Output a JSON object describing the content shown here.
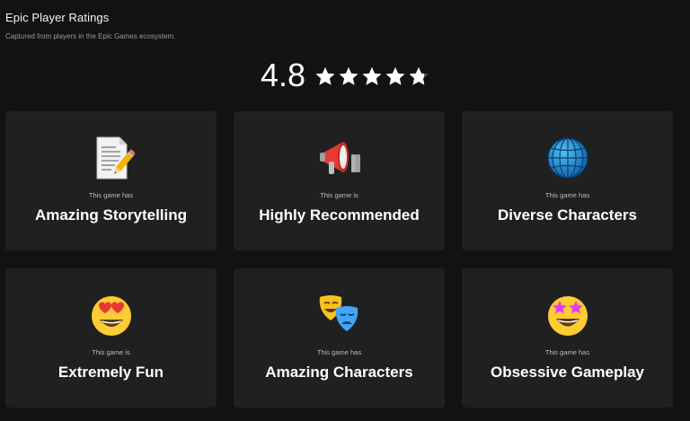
{
  "header": {
    "title": "Epic Player Ratings",
    "subtitle": "Captured from players in the Epic Games ecosystem."
  },
  "rating": {
    "score": "4.8",
    "stars_filled_fraction": 0.96,
    "star_count": 5
  },
  "cards": [
    {
      "icon": "memo-icon",
      "kicker": "This game has",
      "label": "Amazing Storytelling"
    },
    {
      "icon": "megaphone-icon",
      "kicker": "This game is",
      "label": "Highly Recommended"
    },
    {
      "icon": "globe-icon",
      "kicker": "This game has",
      "label": "Diverse Characters"
    },
    {
      "icon": "heart-eyes-icon",
      "kicker": "This game is",
      "label": "Extremely Fun"
    },
    {
      "icon": "theater-masks-icon",
      "kicker": "This game has",
      "label": "Amazing Characters"
    },
    {
      "icon": "star-struck-icon",
      "kicker": "This game has",
      "label": "Obsessive Gameplay"
    }
  ]
}
